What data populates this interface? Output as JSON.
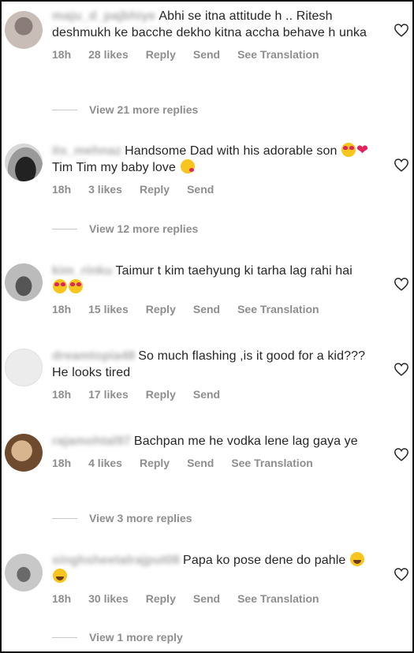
{
  "comments": [
    {
      "username": "maju_d_pajbhiye",
      "text": "Abhi se itna attitude h .. Ritesh deshmukh ke bacche dekho kitna accha behave h unka",
      "time": "18h",
      "likes": "28 likes",
      "reply": "Reply",
      "send": "Send",
      "translation": "See Translation",
      "more_replies": "View 21 more replies"
    },
    {
      "username": "its_mehnaz",
      "text_a": "Handsome Dad with his adorable son",
      "text_b": "Tim Tim my baby love",
      "time": "18h",
      "likes": "3 likes",
      "reply": "Reply",
      "send": "Send",
      "more_replies": "View 12 more replies"
    },
    {
      "username": "kim_rinku",
      "text": "Taimur t kim taehyung ki tarha lag rahi hai",
      "time": "18h",
      "likes": "15 likes",
      "reply": "Reply",
      "send": "Send",
      "translation": "See Translation"
    },
    {
      "username": "dreamtopia48",
      "text": "So much flashing ,is it good for a kid??? He looks tired",
      "time": "18h",
      "likes": "17 likes",
      "reply": "Reply",
      "send": "Send"
    },
    {
      "username": "rajamohtal97",
      "text": "Bachpan me he vodka lene lag gaya ye",
      "time": "18h",
      "likes": "4 likes",
      "reply": "Reply",
      "send": "Send",
      "translation": "See Translation",
      "more_replies": "View 3 more replies"
    },
    {
      "username": "singhsheetalrajput08",
      "text": "Papa ko pose dene do pahle",
      "time": "18h",
      "likes": "30 likes",
      "reply": "Reply",
      "send": "Send",
      "translation": "See Translation",
      "more_replies": "View 1 more reply"
    }
  ],
  "icons": {
    "like": "heart-outline-icon"
  },
  "colors": {
    "text": "#262626",
    "meta": "#8e8e8e",
    "divider": "#c7c7c7"
  }
}
